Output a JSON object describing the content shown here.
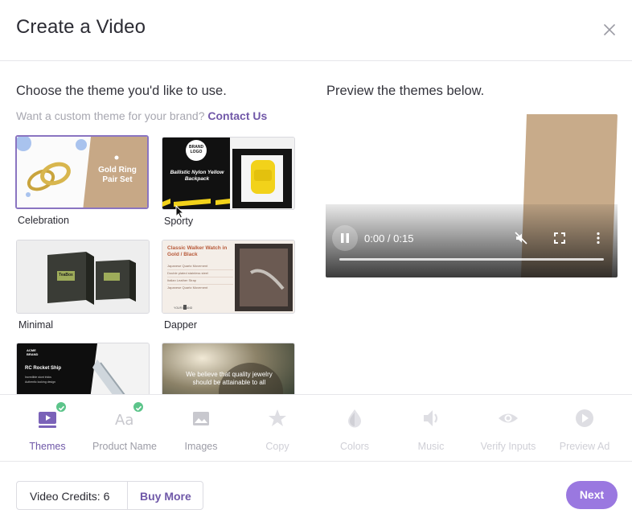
{
  "header": {
    "title": "Create a Video"
  },
  "left": {
    "heading": "Choose the theme you'd like to use.",
    "custom_prompt": "Want a custom theme for your brand?",
    "contact_link": "Contact Us"
  },
  "themes": [
    {
      "label": "Celebration",
      "selected": true,
      "thumb_text": "Gold Ring Pair Set"
    },
    {
      "label": "Sporty",
      "selected": false,
      "thumb_text": "Ballistic Nylon Yellow Backpack",
      "thumb_logo": "BRAND LOGO"
    },
    {
      "label": "Minimal",
      "selected": false,
      "thumb_text": "TeaBox"
    },
    {
      "label": "Dapper",
      "selected": false,
      "thumb_text": "Classic Walker Watch in Gold / Black",
      "thumb_lines": [
        "Japanese Quartz Movement",
        "Double plated stainless steel",
        "Italian Leather Strap",
        "Japanese Quartz Movement"
      ],
      "thumb_brand": "YOUR BRAND"
    },
    {
      "label": "",
      "selected": false,
      "thumb_text": "RC Rocket Ship",
      "thumb_logo": "ACME BRAND",
      "thumb_lines": [
        "Incredible stunt tricks",
        "Authentic looking design"
      ]
    },
    {
      "label": "",
      "selected": false,
      "thumb_text": "We believe that quality jewelry should be attainable to all"
    }
  ],
  "preview": {
    "heading": "Preview the themes below.",
    "time": "0:00 / 0:15",
    "progress": 0
  },
  "steps": [
    {
      "label": "Themes",
      "icon": "video-icon",
      "state": "active",
      "complete": true
    },
    {
      "label": "Product Name",
      "icon": "text-aa-icon",
      "state": "done",
      "complete": true
    },
    {
      "label": "Images",
      "icon": "image-icon",
      "state": "done",
      "complete": false
    },
    {
      "label": "Copy",
      "icon": "star-icon",
      "state": "pending",
      "complete": false
    },
    {
      "label": "Colors",
      "icon": "droplet-icon",
      "state": "pending",
      "complete": false
    },
    {
      "label": "Music",
      "icon": "speaker-icon",
      "state": "pending",
      "complete": false
    },
    {
      "label": "Verify Inputs",
      "icon": "eye-icon",
      "state": "pending",
      "complete": false
    },
    {
      "label": "Preview Ad",
      "icon": "play-circle-icon",
      "state": "pending",
      "complete": false
    }
  ],
  "footer": {
    "credits_label": "Video Credits: 6",
    "buy_more": "Buy More",
    "next": "Next"
  },
  "colors": {
    "accent": "#9a78e0",
    "link": "#6f58a8",
    "check": "#5cc48a",
    "tan": "#c8ab8a"
  }
}
